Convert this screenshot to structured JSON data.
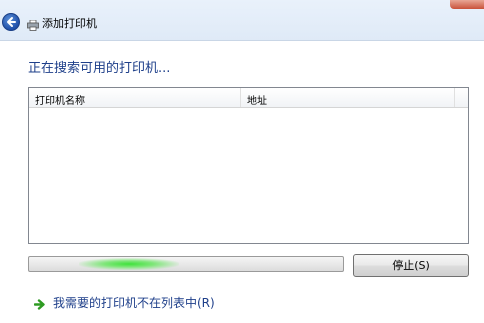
{
  "window": {
    "title": "添加打印机"
  },
  "main": {
    "heading": "正在搜索可用的打印机...",
    "list": {
      "columns": [
        "打印机名称",
        "地址"
      ],
      "rows": []
    },
    "progress": {
      "state": "indeterminate"
    },
    "stop_button_label": "停止(S)",
    "not_listed_link": "我需要的打印机不在列表中(R)"
  },
  "icons": {
    "back": "back-arrow-icon",
    "printer": "printer-icon",
    "link_arrow": "green-arrow-icon"
  },
  "colors": {
    "heading": "#1e3f8a",
    "progress_glow": "#3ee23a",
    "link": "#1e3f8a"
  }
}
